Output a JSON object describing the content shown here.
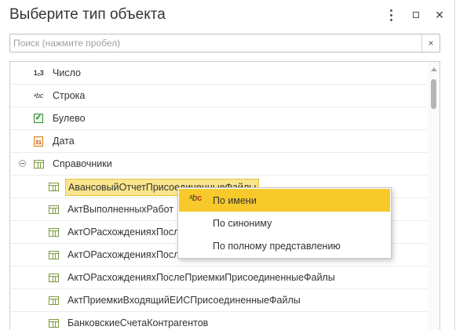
{
  "window": {
    "title": "Выберите тип объекта"
  },
  "search": {
    "placeholder": "Поиск (нажмите пробел)",
    "value": "",
    "clear_glyph": "×"
  },
  "tree": {
    "primitives": [
      {
        "icon": "number-type-icon",
        "icon_text": "1₂3",
        "label": "Число"
      },
      {
        "icon": "string-type-icon",
        "icon_text": "ᵃbc",
        "label": "Строка"
      },
      {
        "icon": "boolean-type-icon",
        "icon_text": "✓",
        "label": "Булево"
      },
      {
        "icon": "date-type-icon",
        "icon_text": "31",
        "label": "Дата"
      }
    ],
    "group": {
      "label": "Справочники",
      "expanded": true,
      "items": [
        {
          "label": "АвансовыйОтчетПрисоединенныеФайлы",
          "selected": true
        },
        {
          "label": "АктВыполненныхРабот"
        },
        {
          "label": "АктОРасхожденияхПосле"
        },
        {
          "label": "АктОРасхожденияхПосле"
        },
        {
          "label": "АктОРасхожденияхПослеПриемкиПрисоединенныеФайлы"
        },
        {
          "label": "АктПриемкиВходящийЕИСПрисоединенныеФайлы"
        },
        {
          "label": "БанковскиеСчетаКонтрагентов"
        }
      ]
    }
  },
  "context_menu": {
    "items": [
      {
        "label": "По имени",
        "active": true,
        "icon": "sort-by-name-icon"
      },
      {
        "label": "По синониму",
        "active": false
      },
      {
        "label": "По полному представлению",
        "active": false
      }
    ]
  },
  "colors": {
    "menu_highlight": "#f7c92b",
    "selection_fill": "#fbe58c",
    "table_icon": "#7c9a3e"
  }
}
